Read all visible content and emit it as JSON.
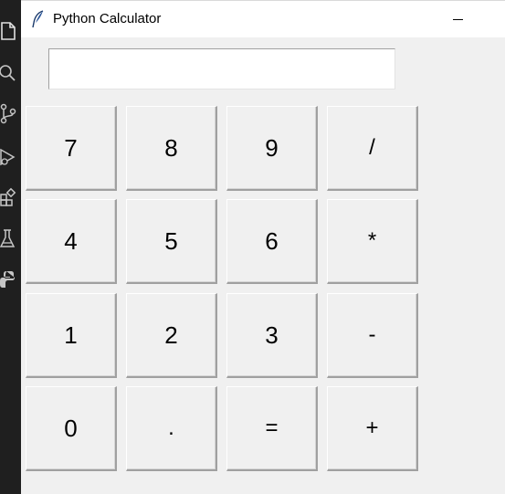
{
  "window": {
    "title": "Python Calculator",
    "icon": "feather-icon",
    "minimize_icon": "minimize-icon"
  },
  "activity_bar": {
    "icons": [
      "explorer-icon",
      "search-icon",
      "source-control-icon",
      "run-debug-icon",
      "extensions-icon",
      "testing-icon",
      "python-icon"
    ]
  },
  "display": {
    "value": "",
    "placeholder": ""
  },
  "keypad": {
    "rows": [
      [
        {
          "label": "7"
        },
        {
          "label": "8"
        },
        {
          "label": "9"
        },
        {
          "label": "/"
        }
      ],
      [
        {
          "label": "4"
        },
        {
          "label": "5"
        },
        {
          "label": "6"
        },
        {
          "label": "*"
        }
      ],
      [
        {
          "label": "1"
        },
        {
          "label": "2"
        },
        {
          "label": "3"
        },
        {
          "label": "-"
        }
      ],
      [
        {
          "label": "0"
        },
        {
          "label": "."
        },
        {
          "label": "="
        },
        {
          "label": "+"
        }
      ]
    ]
  },
  "colors": {
    "window_bg": "#f0f0f0",
    "titlebar_bg": "#ffffff",
    "activity_bar_bg": "#1f1f1f",
    "activity_icon": "#c5c5c5"
  }
}
